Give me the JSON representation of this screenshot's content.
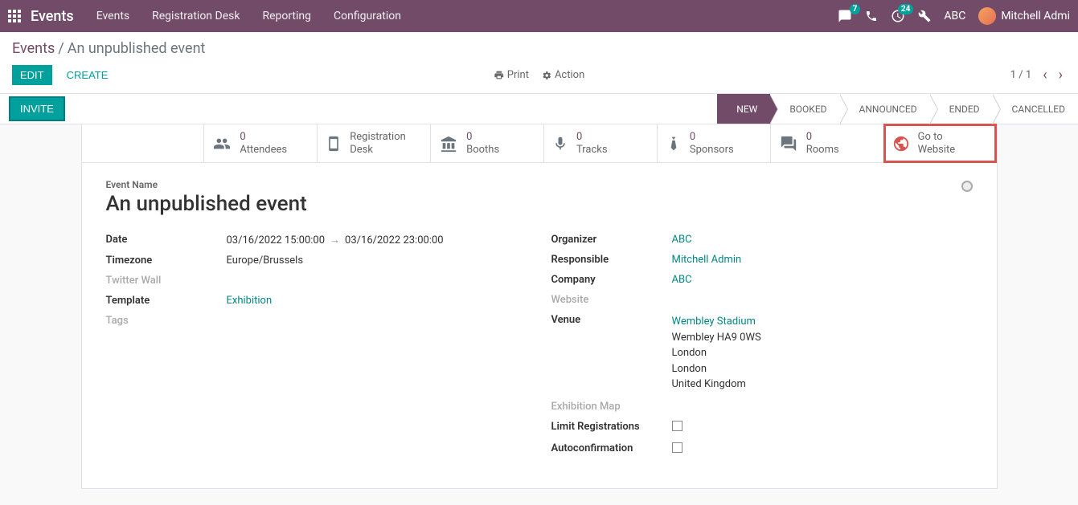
{
  "topbar": {
    "app_title": "Events",
    "nav": [
      "Events",
      "Registration Desk",
      "Reporting",
      "Configuration"
    ],
    "chat_badge": "7",
    "activity_badge": "24",
    "company": "ABC",
    "user": "Mitchell Admi"
  },
  "breadcrumb": {
    "root": "Events",
    "current": "An unpublished event"
  },
  "actions": {
    "edit": "EDIT",
    "create": "CREATE",
    "print": "Print",
    "action": "Action",
    "pager": "1 / 1",
    "invite": "INVITE"
  },
  "statuses": [
    "NEW",
    "BOOKED",
    "ANNOUNCED",
    "ENDED",
    "CANCELLED"
  ],
  "stats": {
    "attendees": {
      "count": "0",
      "label": "Attendees"
    },
    "regdesk": {
      "label1": "Registration",
      "label2": "Desk"
    },
    "booths": {
      "count": "0",
      "label": "Booths"
    },
    "tracks": {
      "count": "0",
      "label": "Tracks"
    },
    "sponsors": {
      "count": "0",
      "label": "Sponsors"
    },
    "rooms": {
      "count": "0",
      "label": "Rooms"
    },
    "website": {
      "label1": "Go to",
      "label2": "Website"
    }
  },
  "form": {
    "event_name_label": "Event Name",
    "event_name": "An unpublished event",
    "left": {
      "date_label": "Date",
      "date_from": "03/16/2022 15:00:00",
      "date_to": "03/16/2022 23:00:00",
      "tz_label": "Timezone",
      "tz": "Europe/Brussels",
      "twitter_label": "Twitter Wall",
      "template_label": "Template",
      "template": "Exhibition",
      "tags_label": "Tags"
    },
    "right": {
      "organizer_label": "Organizer",
      "organizer": "ABC",
      "responsible_label": "Responsible",
      "responsible": "Mitchell Admin",
      "company_label": "Company",
      "company": "ABC",
      "website_label": "Website",
      "venue_label": "Venue",
      "venue_name": "Wembley Stadium",
      "venue_l2": "Wembley HA9 0WS",
      "venue_l3": "London",
      "venue_l4": "London",
      "venue_l5": "United Kingdom",
      "exmap_label": "Exhibition Map",
      "limitreg_label": "Limit Registrations",
      "autoconf_label": "Autoconfirmation"
    }
  }
}
